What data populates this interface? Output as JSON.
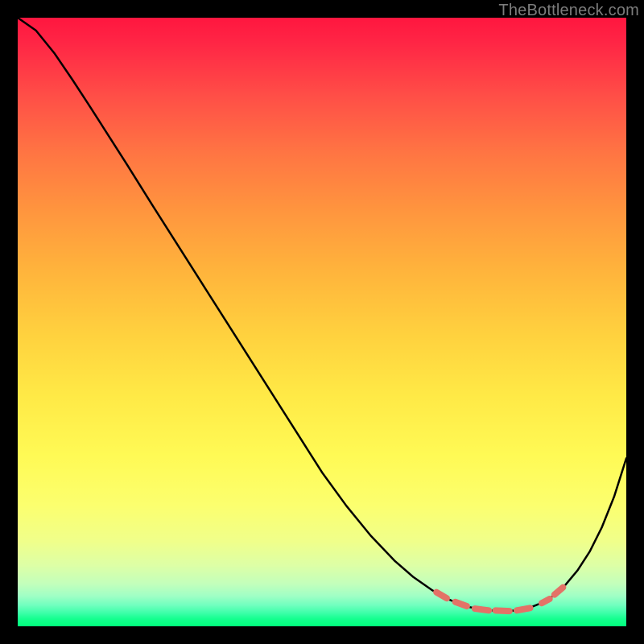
{
  "watermark": "TheBottleneck.com",
  "colors": {
    "curve": "#000000",
    "marker": "#e37267"
  },
  "chart_data": {
    "type": "line",
    "title": "",
    "xlabel": "",
    "ylabel": "",
    "xlim": [
      0,
      100
    ],
    "ylim": [
      0,
      100
    ],
    "grid": false,
    "legend": false,
    "notes": "No axis labels or tick labels are rendered in the source image; y is inferred as 100*(distance from bottom)/plotHeight. Marker segments highlight portions of the curve near the minimum.",
    "series": [
      {
        "name": "curve",
        "kind": "line",
        "x": [
          0,
          3,
          6,
          9,
          12,
          15,
          18,
          22,
          26,
          30,
          34,
          38,
          42,
          46,
          50,
          54,
          58,
          62,
          65,
          68,
          70,
          72,
          74,
          76,
          78,
          80,
          82,
          84,
          86,
          88,
          90,
          92,
          94,
          96,
          98,
          100
        ],
        "y": [
          100.0,
          97.9,
          94.2,
          89.8,
          85.2,
          80.5,
          75.8,
          69.4,
          63.1,
          56.8,
          50.5,
          44.2,
          37.9,
          31.6,
          25.3,
          19.8,
          14.9,
          10.7,
          8.1,
          6.0,
          4.8,
          3.9,
          3.2,
          2.8,
          2.6,
          2.5,
          2.6,
          3.0,
          3.8,
          5.0,
          6.8,
          9.2,
          12.3,
          16.3,
          21.3,
          27.6
        ]
      },
      {
        "name": "markers",
        "kind": "segments",
        "segments": [
          {
            "x": [
              68.8,
              70.5
            ],
            "y": [
              5.6,
              4.6
            ]
          },
          {
            "x": [
              71.9,
              73.8
            ],
            "y": [
              4.0,
              3.3
            ]
          },
          {
            "x": [
              75.1,
              77.4
            ],
            "y": [
              2.9,
              2.6
            ]
          },
          {
            "x": [
              78.5,
              80.8
            ],
            "y": [
              2.6,
              2.5
            ]
          },
          {
            "x": [
              82.0,
              84.2
            ],
            "y": [
              2.6,
              3.0
            ]
          },
          {
            "x": [
              86.1,
              87.4
            ],
            "y": [
              3.8,
              4.5
            ]
          },
          {
            "x": [
              88.2,
              89.6
            ],
            "y": [
              5.2,
              6.4
            ]
          }
        ]
      }
    ]
  }
}
